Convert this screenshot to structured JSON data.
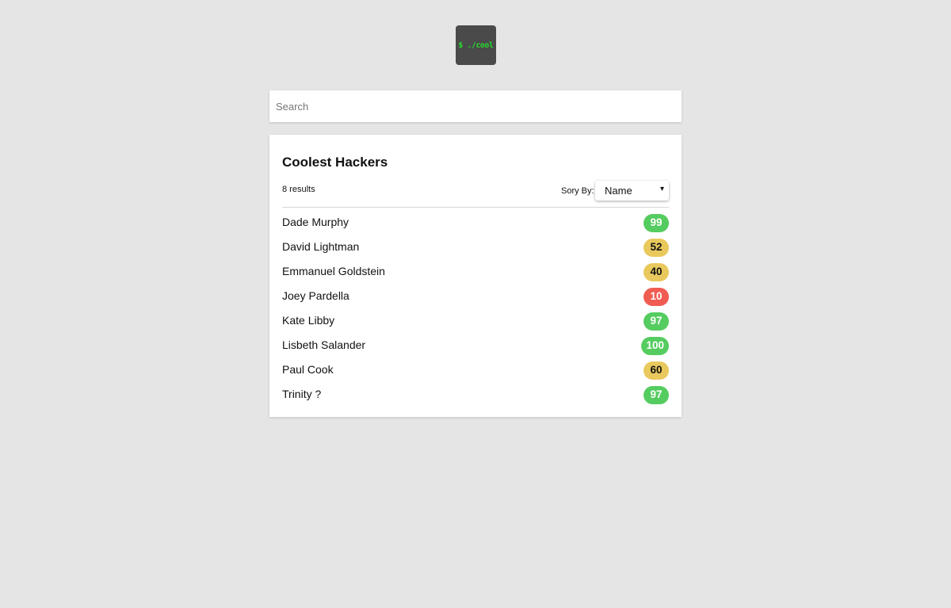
{
  "logo": {
    "text": "$ ./cool"
  },
  "search": {
    "placeholder": "Search",
    "value": ""
  },
  "card": {
    "title": "Coolest Hackers",
    "results_count": "8 results",
    "sort_label": "Sory By:",
    "sort_selected": "Name"
  },
  "hackers": [
    {
      "name": "Dade Murphy",
      "score": "99",
      "level": "high"
    },
    {
      "name": "David Lightman",
      "score": "52",
      "level": "mid"
    },
    {
      "name": "Emmanuel Goldstein",
      "score": "40",
      "level": "mid"
    },
    {
      "name": "Joey Pardella",
      "score": "10",
      "level": "low"
    },
    {
      "name": "Kate Libby",
      "score": "97",
      "level": "high"
    },
    {
      "name": "Lisbeth Salander",
      "score": "100",
      "level": "high"
    },
    {
      "name": "Paul Cook",
      "score": "60",
      "level": "mid"
    },
    {
      "name": "Trinity ?",
      "score": "97",
      "level": "high"
    }
  ],
  "colors": {
    "background": "#e5e5e5",
    "logo_bg": "#4a4a4a",
    "logo_text": "#22e02a",
    "badge_high": "#55cc5f",
    "badge_mid": "#e9c95d",
    "badge_low": "#f05b52"
  }
}
